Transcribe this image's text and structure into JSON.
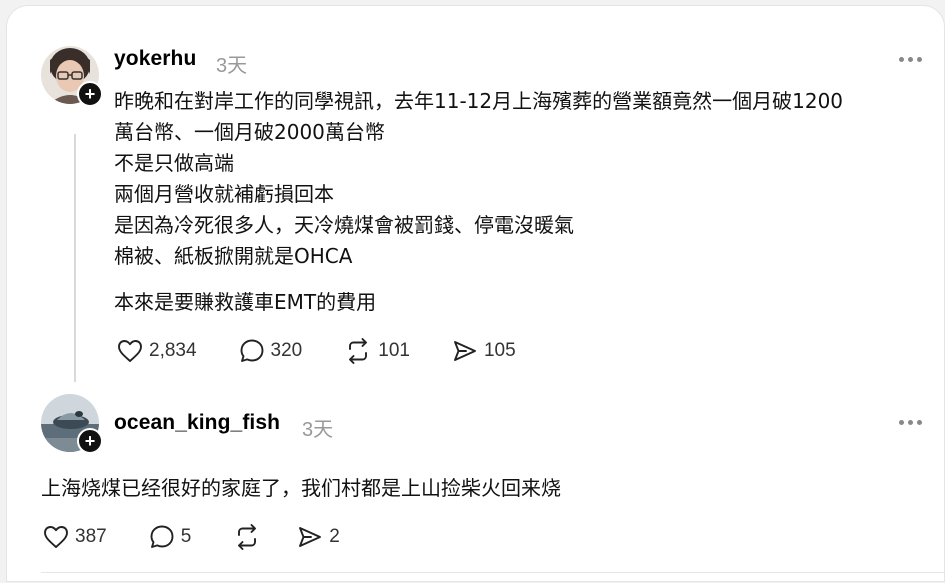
{
  "posts": [
    {
      "username": "yokerhu",
      "time": "3天",
      "body": [
        "昨晚和在對岸工作的同學視訊，去年11-12月上海殯葬的營業額竟然一個月破1200",
        "萬台幣、一個月破2000萬台幣",
        "不是只做高端",
        "兩個月營收就補虧損回本",
        "是因為冷死很多人，天冷燒煤會被罰錢、停電沒暖氣",
        "棉被、紙板掀開就是OHCA",
        "",
        "本來是要賺救護車EMT的費用"
      ],
      "likes": "2,834",
      "replies": "320",
      "reposts": "101",
      "shares": "105"
    },
    {
      "username": "ocean_king_fish",
      "time": "3天",
      "body": [
        "上海烧煤已经很好的家庭了，我们村都是上山捡柴火回来烧"
      ],
      "likes": "387",
      "replies": "5",
      "reposts": "",
      "shares": "2"
    }
  ],
  "follow_symbol": "+"
}
